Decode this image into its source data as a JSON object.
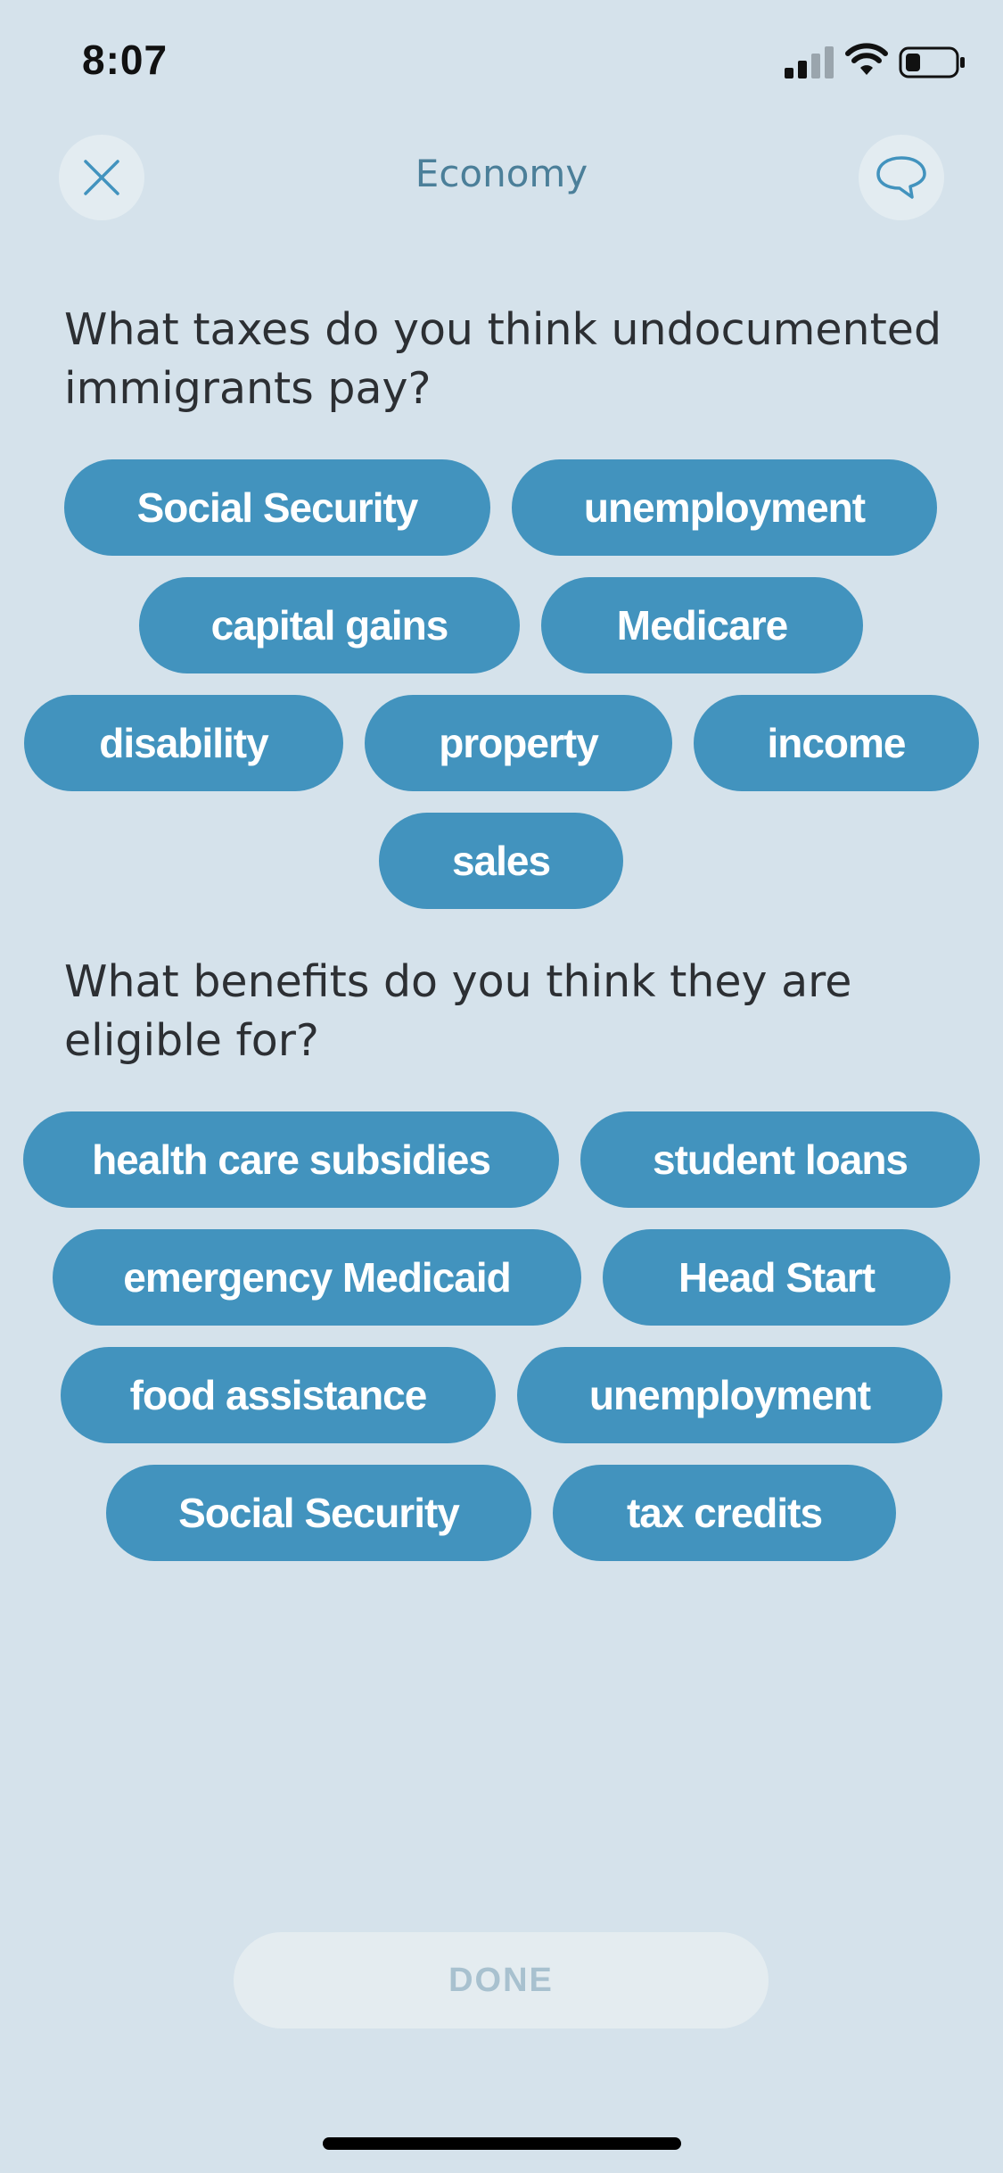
{
  "status_bar": {
    "time": "8:07"
  },
  "header": {
    "title": "Economy"
  },
  "question_taxes": "What taxes do you think undocumented immigrants pay?",
  "taxes": [
    "Social Security",
    "unemployment",
    "capital gains",
    "Medicare",
    "disability",
    "property",
    "income",
    "sales"
  ],
  "question_benefits": "What benefits do you think they are eligible for?",
  "benefits": [
    "health care subsidies",
    "student loans",
    "emergency Medicaid",
    "Head Start",
    "food assistance",
    "unemployment",
    "Social Security",
    "tax credits"
  ],
  "done_label": "DONE",
  "colors": {
    "background": "#d5e2eb",
    "pill": "#4293be",
    "title": "#4b7f99",
    "done_text": "#a8c1cf"
  },
  "icons": {
    "close": "close-icon",
    "chat": "chat-bubble-icon"
  }
}
